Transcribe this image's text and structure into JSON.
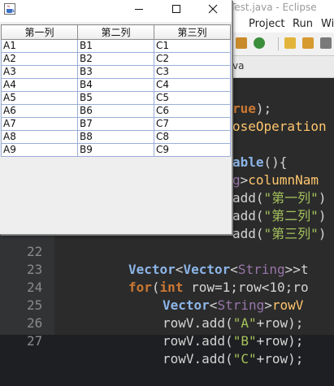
{
  "eclipse": {
    "window_title": "Test.java - Eclipse",
    "menu": [
      "Project",
      "Run",
      "Wi"
    ],
    "tab_label": "va",
    "code_lines": [
      {
        "num": "",
        "text": "rue);"
      },
      {
        "num": "",
        "text": "oseOperation"
      },
      {
        "num": "",
        "text": ""
      },
      {
        "num": "",
        "text": "able(){"
      },
      {
        "num": "",
        "text": "g>columnNam"
      },
      {
        "num": "",
        "text": "add(\"第一列\")"
      },
      {
        "num": "",
        "text": "add(\"第二列\")"
      },
      {
        "num": "",
        "text": "add(\"第三列\")"
      },
      {
        "num": "22",
        "text": "Vector<Vector<String>>t"
      },
      {
        "num": "23",
        "text": "for(int row=1;row<10;ro"
      },
      {
        "num": "24",
        "text": "Vector<String>rowV"
      },
      {
        "num": "25",
        "text": "rowV.add(\"A\"+row);"
      },
      {
        "num": "26",
        "text": "rowV.add(\"B\"+row);"
      },
      {
        "num": "27",
        "text": "rowV.add(\"C\"+row);"
      }
    ]
  },
  "jframe": {
    "title": "",
    "icon": "java-cup-icon",
    "buttons": [
      "minimize-icon",
      "maximize-icon",
      "close-icon"
    ]
  },
  "table": {
    "columns": [
      "第一列",
      "第二列",
      "第三列"
    ],
    "rows": [
      [
        "A1",
        "B1",
        "C1"
      ],
      [
        "A2",
        "B2",
        "C2"
      ],
      [
        "A3",
        "B3",
        "C3"
      ],
      [
        "A4",
        "B4",
        "C4"
      ],
      [
        "A5",
        "B5",
        "C5"
      ],
      [
        "A6",
        "B6",
        "C6"
      ],
      [
        "A7",
        "B7",
        "C7"
      ],
      [
        "A8",
        "B8",
        "C8"
      ],
      [
        "A9",
        "B9",
        "C9"
      ]
    ]
  },
  "colors": {
    "editor_bg": "#2b2b2b",
    "keyword": "#cc7832",
    "string": "#a5c25c",
    "grid_line": "#9aaed8"
  }
}
